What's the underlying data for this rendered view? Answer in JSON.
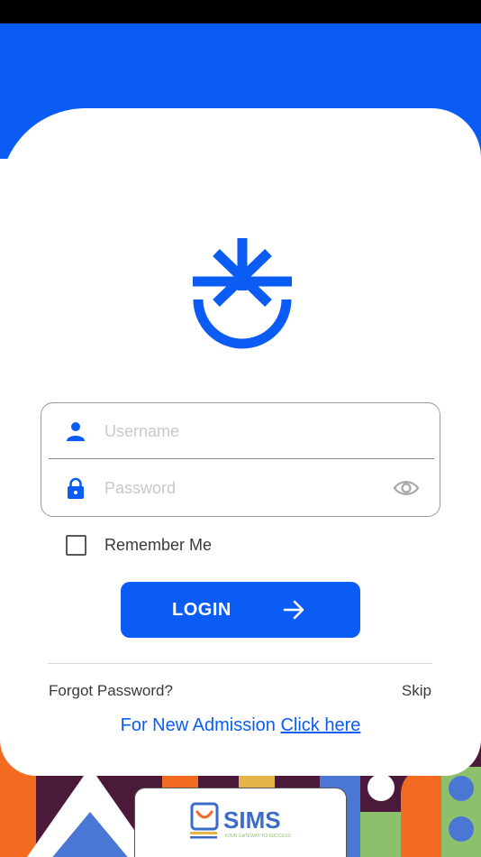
{
  "login_form": {
    "username_placeholder": "Username",
    "password_placeholder": "Password"
  },
  "remember_me": {
    "label": "Remember Me",
    "checked": false
  },
  "login_button": {
    "label": "LOGIN"
  },
  "links": {
    "forgot_password": "Forgot Password?",
    "skip": "Skip",
    "admission_prefix": "For New Admission ",
    "admission_link": "Click here"
  },
  "footer_logo": {
    "name": "SIMS",
    "tagline": "YOUR GATEWAY TO SUCCESS"
  },
  "colors": {
    "brand_blue": "#0A5CF5",
    "pattern_bg": "#4B1A3A"
  },
  "icons": {
    "user": "user-icon",
    "lock": "lock-icon",
    "eye": "eye-icon",
    "arrow": "arrow-right-icon",
    "checkbox": "checkbox-unchecked"
  }
}
